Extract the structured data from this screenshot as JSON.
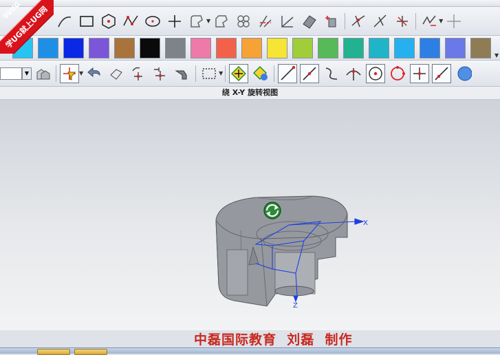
{
  "banner": {
    "site": "9SUG",
    "slogan": "学UG就上UG网"
  },
  "view_title": "绕 X-Y 旋转视图",
  "credit": {
    "org": "中磊国际教育",
    "author": "刘磊",
    "action": "制作"
  },
  "axis_labels": {
    "x": "X",
    "z": "Z"
  },
  "toolbar_icons_row1": [
    "spline-icon",
    "rectangle-icon",
    "polygon-icon",
    "studio-spline-icon",
    "ellipse-icon",
    "point-icon",
    "fillet-icon",
    "chamfer-icon",
    "pattern-icon",
    "trim-icon",
    "extend-icon",
    "offset-curve-icon",
    "project-icon",
    "dimension-icon",
    "constraint-icon",
    "snap-icon"
  ],
  "palette_colors": [
    "#27c4f2",
    "#1f8fe6",
    "#0a28e6",
    "#7b56d8",
    "#a8743c",
    "#0a0a0a",
    "#7e8387",
    "#ee7aa8",
    "#f2624a",
    "#f6a235",
    "#f6e534",
    "#9fce3a",
    "#57b957",
    "#22b291",
    "#1fb4c8",
    "#26b1ee",
    "#2e7fe4",
    "#6a78e8",
    "#8f7c55"
  ],
  "palette_trailing_color": "#e8191b",
  "toolbar_icons_row3": [
    "zoom-select-dropdown",
    "layer-settings-icon",
    "snap-filter-icon",
    "undo-icon",
    "eraser-icon",
    "rotate-snap-icon",
    "move-snap-icon",
    "inference-icon",
    "select-box-icon",
    "select-all-icon",
    "deselect-icon",
    "line-endpoint-icon",
    "line-midpoint-icon",
    "curve-point-icon",
    "intersection-icon",
    "arc-center-icon",
    "quadrant-icon",
    "exist-point-icon",
    "point-on-curve-icon",
    "view-sphere-icon"
  ],
  "colors": {
    "credit_red": "#c8281e",
    "banner_red": "#d8131b",
    "axis_blue": "#1f3fe0"
  }
}
